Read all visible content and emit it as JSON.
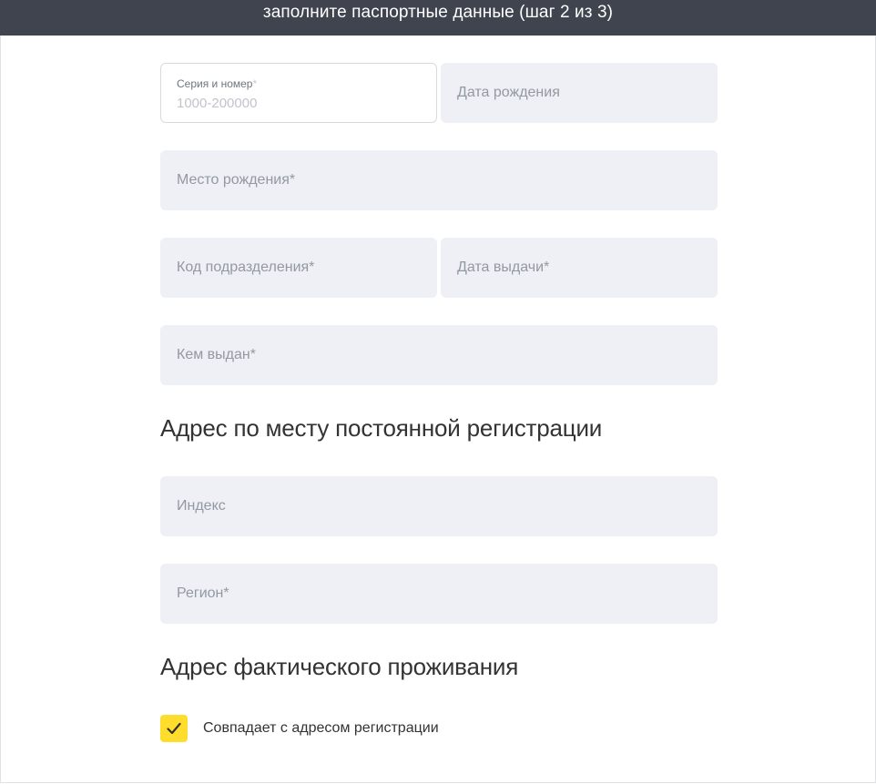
{
  "header": {
    "title": "заполните паспортные данные (шаг 2 из 3)"
  },
  "passport": {
    "series_number": {
      "label": "Серия и номер",
      "required_mark": "*",
      "placeholder": "1000-200000"
    },
    "birth_date": {
      "placeholder": "Дата рождения"
    },
    "birth_place": {
      "placeholder": "Место рождения*"
    },
    "division_code": {
      "placeholder": "Код подразделения*"
    },
    "issue_date": {
      "placeholder": "Дата выдачи*"
    },
    "issued_by": {
      "placeholder": "Кем выдан*"
    }
  },
  "registration_address": {
    "title": "Адрес по месту постоянной регистрации",
    "index": {
      "placeholder": "Индекс"
    },
    "region": {
      "placeholder": "Регион*"
    }
  },
  "actual_address": {
    "title": "Адрес фактического проживания",
    "same_as_registration": {
      "label": "Совпадает с адресом регистрации",
      "checked": true
    }
  },
  "colors": {
    "header_bg": "#3f444f",
    "field_bg": "#eef0f5",
    "accent": "#ffdd2d"
  }
}
